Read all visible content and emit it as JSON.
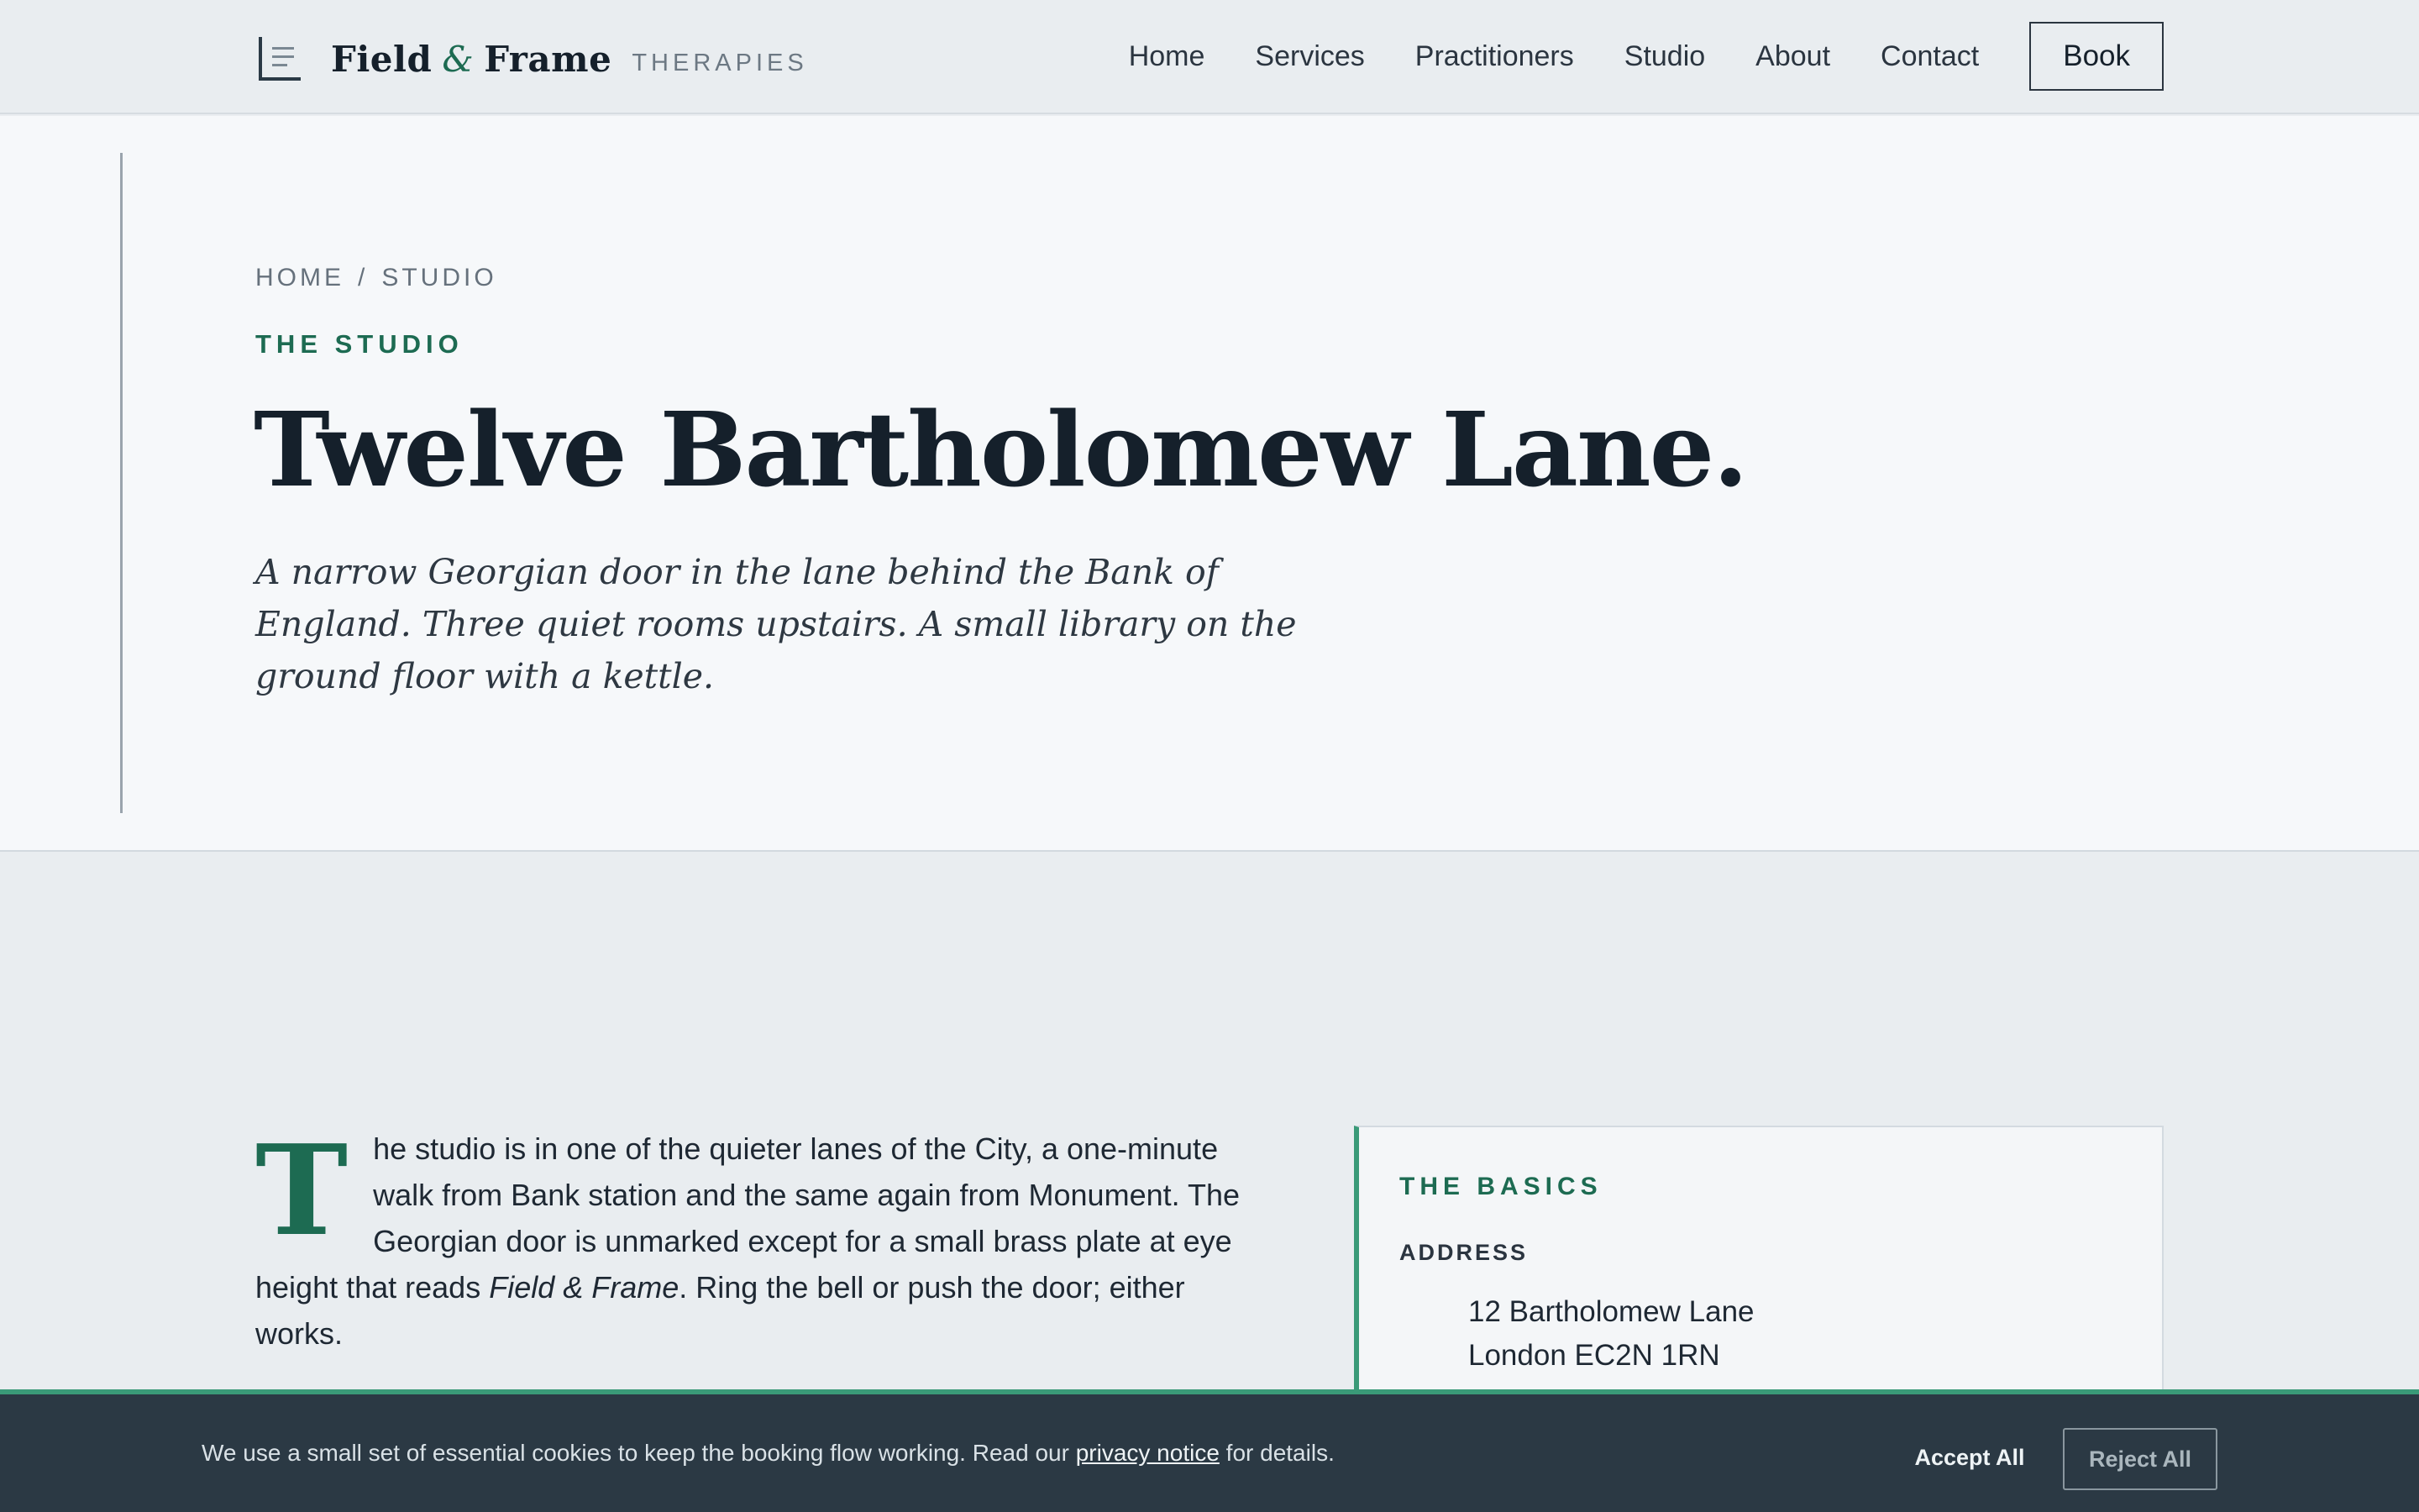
{
  "header": {
    "brand_name_1": "Field",
    "brand_amp": "&",
    "brand_name_2": "Frame",
    "brand_sub": "THERAPIES",
    "nav": [
      "Home",
      "Services",
      "Practitioners",
      "Studio",
      "About",
      "Contact"
    ],
    "book_label": "Book"
  },
  "hero": {
    "breadcrumb": [
      "HOME",
      "STUDIO"
    ],
    "breadcrumb_sep": "/",
    "eyebrow": "THE STUDIO",
    "title": "Twelve Bartholomew Lane.",
    "lede": "A narrow Georgian door in the lane behind the Bank of England. Three quiet rooms upstairs. A small library on the ground floor with a kettle."
  },
  "intro": {
    "dropcap": "T",
    "text_before": "he studio is in one of the quieter lanes of the City, a one-minute walk from Bank station and the same again from Monument. The Georgian door is unmarked except for a small brass plate at eye height that reads ",
    "text_em": "Field & Frame",
    "text_after": ". Ring the bell or push the door; either works."
  },
  "basics": {
    "title": "THE BASICS",
    "address_label": "ADDRESS",
    "address_line_1": "12 Bartholomew Lane",
    "address_line_2": "London EC2N 1RN"
  },
  "cookie": {
    "text_before": "We use a small set of essential cookies to keep the booking flow working. Read our ",
    "link": "privacy notice",
    "text_after": " for details.",
    "accept_label": "Accept All",
    "reject_label": "Reject All"
  },
  "colors": {
    "accent": "#1d6b52",
    "accent_light": "#3a9a78",
    "ink": "#15202b",
    "cookie_bg": "#2b3944"
  }
}
